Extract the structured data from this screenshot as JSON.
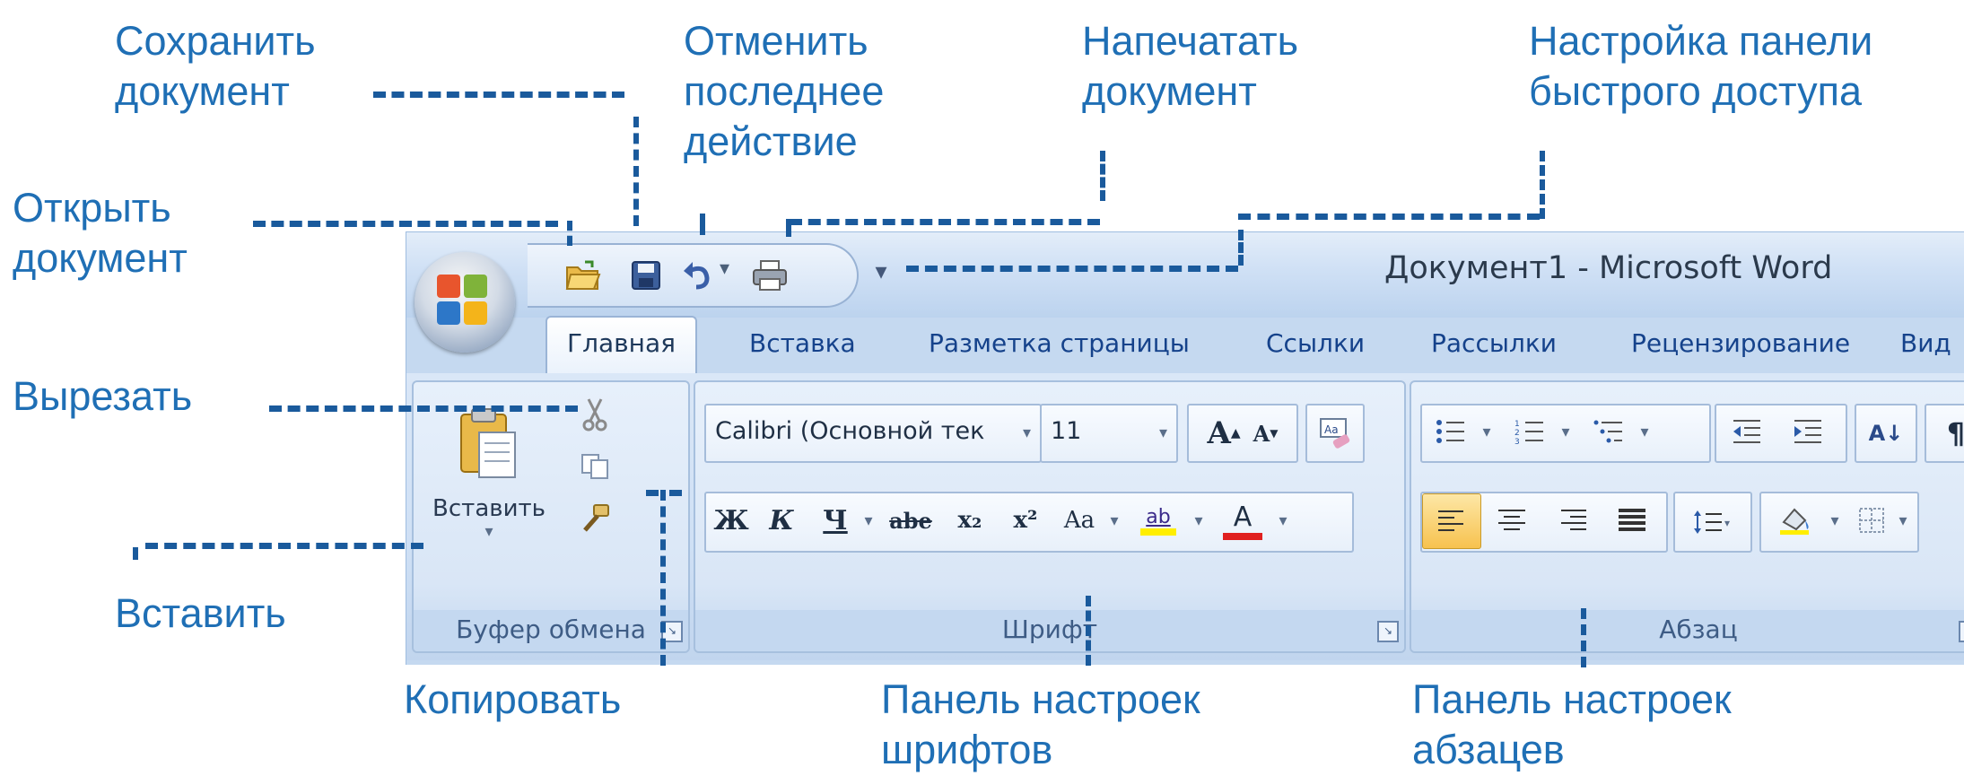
{
  "callouts": {
    "save": "Сохранить\nдокумент",
    "undo": "Отменить\nпоследнее\nдействие",
    "print": "Напечатать\nдокумент",
    "qat_settings": "Настройка панели\nбыстрого доступа",
    "open": "Открыть\nдокумент",
    "cut": "Вырезать",
    "paste": "Вставить",
    "copy": "Копировать",
    "font_panel": "Панель настроек\nшрифтов",
    "para_panel": "Панель настроек\nабзацев"
  },
  "window": {
    "title": "Документ1 - Microsoft Word",
    "customize_glyph": "▾"
  },
  "tabs": [
    {
      "label": "Главная",
      "active": true
    },
    {
      "label": "Вставка"
    },
    {
      "label": "Разметка страницы"
    },
    {
      "label": "Ссылки"
    },
    {
      "label": "Рассылки"
    },
    {
      "label": "Рецензирование"
    },
    {
      "label": "Вид"
    }
  ],
  "groups": {
    "clipboard": {
      "label": "Буфер обмена",
      "paste_label": "Вставить"
    },
    "font": {
      "label": "Шрифт",
      "font_name": "Calibri (Основной тек",
      "font_size": "11",
      "bold": "Ж",
      "italic": "К",
      "underline": "Ч",
      "strike": "abe",
      "subscript": "x₂",
      "superscript": "x²",
      "change_case": "Aa",
      "grow": "A",
      "shrink": "A",
      "highlight": "ab",
      "font_color": "A"
    },
    "paragraph": {
      "label": "Абзац",
      "show_marks": "¶",
      "sort": "А↓"
    }
  },
  "colors": {
    "callout_text": "#1f6fb5",
    "leader_line": "#1a5a9c",
    "tab_text": "#15428b",
    "highlight_yellow": "#ffee00",
    "font_color_red": "#e02020",
    "office_logo": [
      "#e8552d",
      "#7fb33a",
      "#f4b41a",
      "#2d77c8"
    ]
  },
  "icons": [
    "office-button-icon",
    "open-folder-icon",
    "save-disk-icon",
    "undo-icon",
    "print-icon",
    "customize-arrow-icon",
    "cut-scissors-icon",
    "copy-icon",
    "format-painter-icon",
    "paste-clipboard-icon",
    "bullets-icon",
    "numbering-icon",
    "multilevel-list-icon",
    "decrease-indent-icon",
    "increase-indent-icon",
    "sort-icon",
    "show-marks-icon",
    "align-left-icon",
    "align-center-icon",
    "align-right-icon",
    "justify-icon",
    "line-spacing-icon",
    "shading-icon",
    "borders-icon"
  ]
}
